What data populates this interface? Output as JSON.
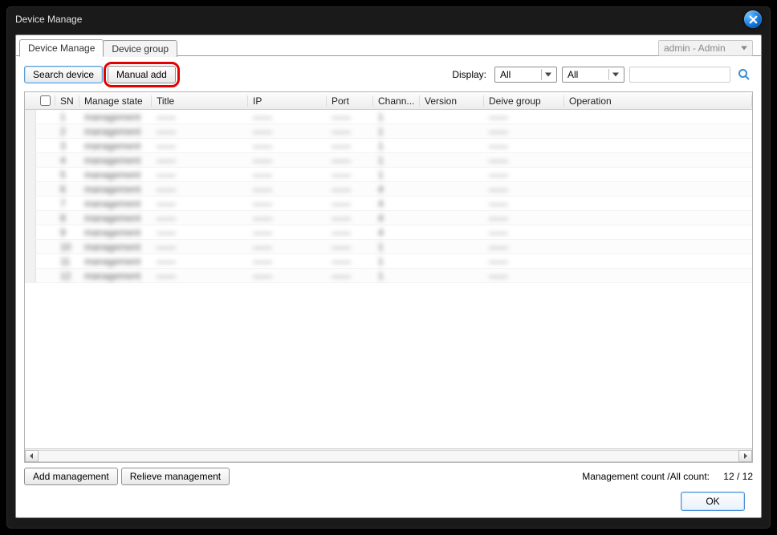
{
  "window": {
    "title": "Device Manage"
  },
  "tabs": {
    "active": "Device Manage",
    "items": [
      {
        "label": "Device Manage"
      },
      {
        "label": "Device group"
      }
    ]
  },
  "user_select": {
    "value": "admin - Admin"
  },
  "toolbar": {
    "search_device": "Search device",
    "manual_add": "Manual add",
    "display_label": "Display:",
    "filter1": "All",
    "filter2": "All",
    "search_placeholder": ""
  },
  "columns": {
    "sn": "SN",
    "manage_state": "Manage state",
    "title": "Title",
    "ip": "IP",
    "port": "Port",
    "channels": "Chann...",
    "version": "Version",
    "device_group": "Deive group",
    "operation": "Operation"
  },
  "rows": [
    {
      "sn": "1",
      "mstate": "management",
      "title": "——",
      "ip": "——",
      "port": "——",
      "chan": "1",
      "ver": "",
      "grp": "——"
    },
    {
      "sn": "2",
      "mstate": "management",
      "title": "——",
      "ip": "——",
      "port": "——",
      "chan": "1",
      "ver": "",
      "grp": "——"
    },
    {
      "sn": "3",
      "mstate": "management",
      "title": "——",
      "ip": "——",
      "port": "——",
      "chan": "1",
      "ver": "",
      "grp": "——"
    },
    {
      "sn": "4",
      "mstate": "management",
      "title": "——",
      "ip": "——",
      "port": "——",
      "chan": "1",
      "ver": "",
      "grp": "——"
    },
    {
      "sn": "5",
      "mstate": "management",
      "title": "——",
      "ip": "——",
      "port": "——",
      "chan": "1",
      "ver": "",
      "grp": "——"
    },
    {
      "sn": "6",
      "mstate": "management",
      "title": "——",
      "ip": "——",
      "port": "——",
      "chan": "4",
      "ver": "",
      "grp": "——"
    },
    {
      "sn": "7",
      "mstate": "management",
      "title": "——",
      "ip": "——",
      "port": "——",
      "chan": "4",
      "ver": "",
      "grp": "——"
    },
    {
      "sn": "8",
      "mstate": "management",
      "title": "——",
      "ip": "——",
      "port": "——",
      "chan": "4",
      "ver": "",
      "grp": "——"
    },
    {
      "sn": "9",
      "mstate": "management",
      "title": "——",
      "ip": "——",
      "port": "——",
      "chan": "4",
      "ver": "",
      "grp": "——"
    },
    {
      "sn": "10",
      "mstate": "management",
      "title": "——",
      "ip": "——",
      "port": "——",
      "chan": "1",
      "ver": "",
      "grp": "——"
    },
    {
      "sn": "11",
      "mstate": "management",
      "title": "——",
      "ip": "——",
      "port": "——",
      "chan": "1",
      "ver": "",
      "grp": "——"
    },
    {
      "sn": "12",
      "mstate": "management",
      "title": "——",
      "ip": "——",
      "port": "——",
      "chan": "1",
      "ver": "",
      "grp": "——"
    }
  ],
  "bottom": {
    "add_mgmt": "Add management",
    "relieve_mgmt": "Relieve management",
    "count_label": "Management count /All count:",
    "count_value": "12 / 12"
  },
  "dialog": {
    "ok": "OK"
  }
}
